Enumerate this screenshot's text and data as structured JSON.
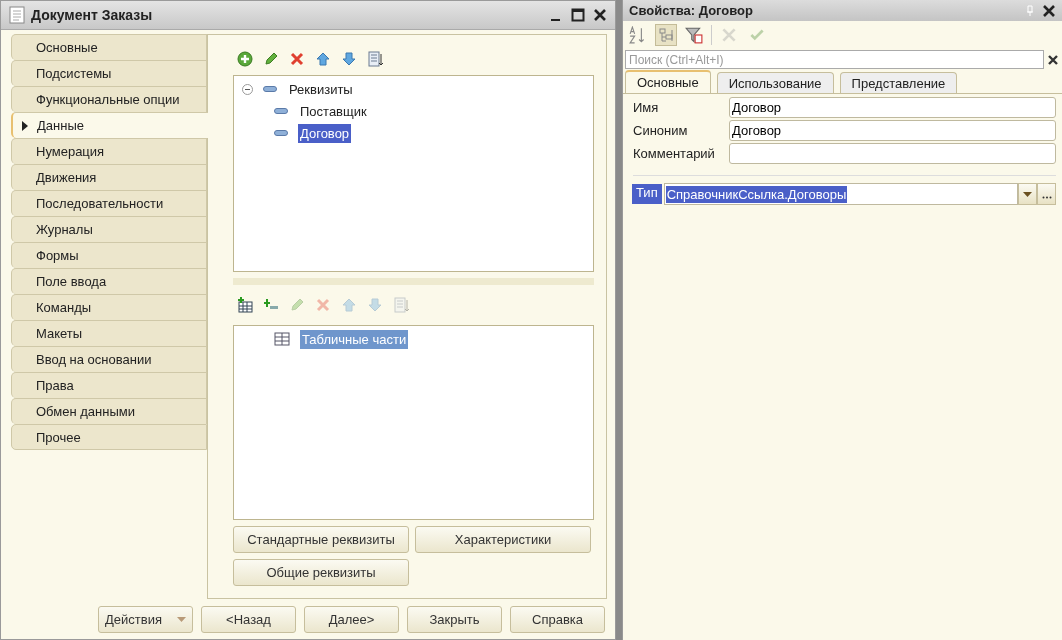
{
  "window": {
    "title": "Документ Заказы"
  },
  "side_tabs": [
    {
      "label": "Основные",
      "selected": false
    },
    {
      "label": "Подсистемы",
      "selected": false
    },
    {
      "label": "Функциональные опции",
      "selected": false
    },
    {
      "label": "Данные",
      "selected": true
    },
    {
      "label": "Нумерация",
      "selected": false
    },
    {
      "label": "Движения",
      "selected": false
    },
    {
      "label": "Последовательности",
      "selected": false
    },
    {
      "label": "Журналы",
      "selected": false
    },
    {
      "label": "Формы",
      "selected": false
    },
    {
      "label": "Поле ввода",
      "selected": false
    },
    {
      "label": "Команды",
      "selected": false
    },
    {
      "label": "Макеты",
      "selected": false
    },
    {
      "label": "Ввод на основании",
      "selected": false
    },
    {
      "label": "Права",
      "selected": false
    },
    {
      "label": "Обмен данными",
      "selected": false
    },
    {
      "label": "Прочее",
      "selected": false
    }
  ],
  "attributes_toolbar": [
    {
      "kind": "add",
      "disabled": false
    },
    {
      "kind": "edit",
      "disabled": false
    },
    {
      "kind": "delete",
      "disabled": false
    },
    {
      "kind": "up",
      "disabled": false
    },
    {
      "kind": "down",
      "disabled": false
    },
    {
      "kind": "sort",
      "disabled": false
    }
  ],
  "attributes_tree": {
    "focused": true,
    "items": [
      {
        "label": "Реквизиты",
        "kind": "group",
        "expanded": true,
        "selected": false,
        "children": [
          {
            "label": "Поставщик",
            "kind": "attribute",
            "selected": false
          },
          {
            "label": "Договор",
            "kind": "attribute",
            "selected": true
          }
        ]
      }
    ]
  },
  "tables_toolbar": [
    {
      "kind": "add-table",
      "disabled": false
    },
    {
      "kind": "add-column",
      "disabled": false
    },
    {
      "kind": "edit",
      "disabled": true
    },
    {
      "kind": "delete",
      "disabled": true
    },
    {
      "kind": "up",
      "disabled": true
    },
    {
      "kind": "down",
      "disabled": true
    },
    {
      "kind": "sort",
      "disabled": true
    }
  ],
  "tables_tree": {
    "focused": false,
    "items": [
      {
        "label": "Табличные части",
        "kind": "table",
        "selected": true
      }
    ]
  },
  "data_buttons": [
    "Стандартные реквизиты",
    "Характеристики",
    "Общие реквизиты"
  ],
  "footer_buttons": [
    {
      "label": "Действия",
      "kind": "menu"
    },
    {
      "label": "<Назад",
      "kind": "plain"
    },
    {
      "label": "Далее>",
      "kind": "plain"
    },
    {
      "label": "Закрыть",
      "kind": "plain"
    },
    {
      "label": "Справка",
      "kind": "plain"
    }
  ],
  "properties": {
    "title": "Свойства: Договор",
    "toolbar": [
      {
        "kind": "sort-az",
        "pressed": false,
        "disabled": false
      },
      {
        "kind": "categories",
        "pressed": true,
        "disabled": false
      },
      {
        "kind": "filter",
        "pressed": false,
        "disabled": false
      },
      {
        "kind": "cancel",
        "pressed": false,
        "disabled": true
      },
      {
        "kind": "apply",
        "pressed": false,
        "disabled": true
      }
    ],
    "search": {
      "placeholder": "Поиск (Ctrl+Alt+I)"
    },
    "tabs": [
      {
        "label": "Основные",
        "selected": true
      },
      {
        "label": "Использование",
        "selected": false
      },
      {
        "label": "Представление",
        "selected": false
      }
    ],
    "fields": [
      {
        "label": "Имя",
        "value": "Договор"
      },
      {
        "label": "Синоним",
        "value": "Договор"
      },
      {
        "label": "Комментарий"
      }
    ],
    "type_field": {
      "label": "Тип",
      "value": "СправочникСсылка.Договоры",
      "selected": true
    }
  }
}
